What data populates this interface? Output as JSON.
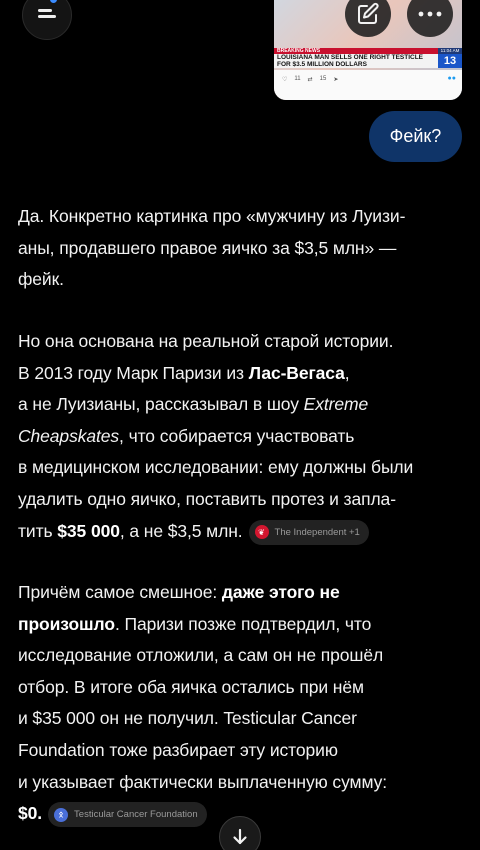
{
  "header": {
    "menu_icon": "menu-icon",
    "notification_color": "#3b8cff",
    "edit_icon": "edit-icon",
    "more_icon": "more-horizontal-icon"
  },
  "attachment": {
    "breaking_label": "BREAKING NEWS",
    "headline_line1": "LOUISIANA MAN SELLS ONE RIGHT TESTICLE",
    "headline_line2": "FOR $3.5 MILLION DOLLARS",
    "time": "11:04 AM",
    "station": "WOKB",
    "channel": "13",
    "replies": "11",
    "retweets": "15"
  },
  "user_message": "Фейк?",
  "answer": {
    "p1": [
      "Да. Конкретно картинка про «мужчину из Луизи-",
      "аны, продавшего правое яичко за $3,5 млн» —",
      "фейк."
    ],
    "p2_l1": "Но она основана на реальной старой истории.",
    "p2_l2_a": "В 2013 году Марк Паризи из ",
    "p2_l2_b": "Лас-Вегаса",
    "p2_l2_c": ",",
    "p2_l3_a": "а не Луизианы, рассказывал в шоу ",
    "p2_l3_b": "Extreme",
    "p2_l4_a": "Cheapskates",
    "p2_l4_b": ", что собирается участвовать",
    "p2_l5": "в медицинском исследовании: ему должны были",
    "p2_l6": "удалить одно яичко, поставить протез и запла-",
    "p2_l7_a": "тить ",
    "p2_l7_b": "$35 000",
    "p2_l7_c": ", а не $3,5 млн.",
    "p3_l1_a": "Причём самое смешное: ",
    "p3_l1_b": "даже этого не",
    "p3_l2_a": "произошло",
    "p3_l2_b": ". Паризи позже подтвердил, что",
    "p3_l3": "исследование отложили, а сам он не прошёл",
    "p3_l4": "отбор. В итоге оба яичка остались при нём",
    "p3_l5": "и $35 000 он не получил. Testicular Cancer",
    "p3_l6": "Foundation тоже разбирает эту историю",
    "p3_l7": "и указывает фактически выплаченную сумму:",
    "p3_l8": "$0."
  },
  "citations": {
    "c1": {
      "label": "The Independent +1",
      "icon": "independent-eagle-icon",
      "color": "#d3162f"
    },
    "c2": {
      "label": "Testicular Cancer Foundation",
      "icon": "awareness-ribbon-icon",
      "color": "#4a6fd8"
    }
  },
  "scroll_button_icon": "arrow-down-icon"
}
